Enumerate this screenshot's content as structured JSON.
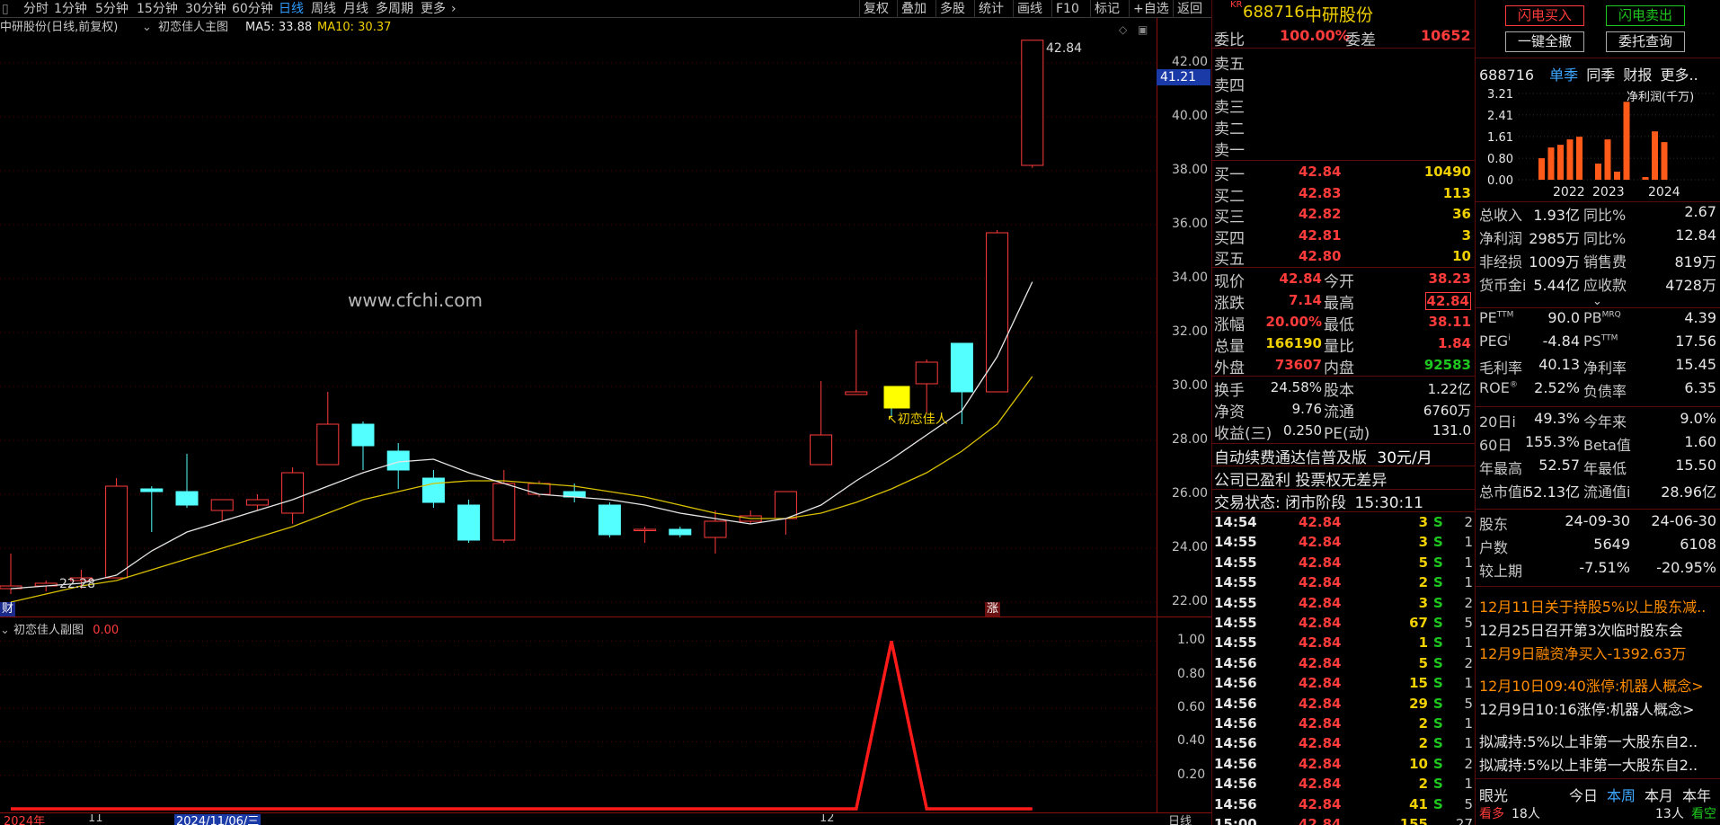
{
  "toolbar": {
    "periods": [
      "分时",
      "1分钟",
      "5分钟",
      "15分钟",
      "30分钟",
      "60分钟",
      "日线",
      "周线",
      "月线",
      "多周期",
      "更多"
    ],
    "active": "日线",
    "right_buttons": [
      "复权",
      "叠加",
      "多股",
      "统计",
      "画线",
      "F10",
      "标记",
      "+自选",
      "返回"
    ]
  },
  "chart": {
    "title": "中研股份(日线,前复权)",
    "indicator": "初恋佳人主图",
    "ma5_label": "MA5: 33.88",
    "ma10_label": "MA10: 30.37",
    "watermark": "www.cfchi.com",
    "high_label": "42.84",
    "low_label": "22.28",
    "marker_label": "初恋佳人",
    "current_price_tag": "41.21",
    "cai_tag": "财",
    "zhang_tag": "涨",
    "yaxis_ticks": [
      "42.00",
      "40.00",
      "38.00",
      "36.00",
      "34.00",
      "32.00",
      "30.00",
      "28.00",
      "26.00",
      "24.00",
      "22.00"
    ],
    "sub_title": "初恋佳人副图",
    "sub_value": "0.00",
    "sub_ticks": [
      "1.00",
      "0.80",
      "0.60",
      "0.40",
      "0.20"
    ],
    "date_labels": [
      "2024年",
      "11",
      "2024/11/06/三",
      "12"
    ],
    "axis_unit": "日线"
  },
  "chart_data": {
    "type": "candlestick",
    "candles": [
      {
        "o": 22.5,
        "h": 23.8,
        "l": 22.3,
        "c": 22.6
      },
      {
        "o": 22.6,
        "h": 22.8,
        "l": 22.4,
        "c": 22.7
      },
      {
        "o": 22.8,
        "h": 23.2,
        "l": 22.5,
        "c": 22.9
      },
      {
        "o": 22.9,
        "h": 26.6,
        "l": 22.9,
        "c": 26.3
      },
      {
        "o": 26.2,
        "h": 26.3,
        "l": 24.6,
        "c": 26.1
      },
      {
        "o": 26.1,
        "h": 27.5,
        "l": 25.5,
        "c": 25.6
      },
      {
        "o": 25.4,
        "h": 25.8,
        "l": 25.0,
        "c": 25.8
      },
      {
        "o": 25.6,
        "h": 26.0,
        "l": 25.4,
        "c": 25.8
      },
      {
        "o": 25.3,
        "h": 27.0,
        "l": 24.9,
        "c": 26.8
      },
      {
        "o": 27.1,
        "h": 29.8,
        "l": 27.1,
        "c": 28.6
      },
      {
        "o": 28.6,
        "h": 28.7,
        "l": 26.9,
        "c": 27.8
      },
      {
        "o": 27.6,
        "h": 27.9,
        "l": 26.2,
        "c": 26.9
      },
      {
        "o": 26.6,
        "h": 26.9,
        "l": 25.5,
        "c": 25.7
      },
      {
        "o": 25.6,
        "h": 25.8,
        "l": 24.2,
        "c": 24.3
      },
      {
        "o": 24.3,
        "h": 26.9,
        "l": 24.2,
        "c": 26.4
      },
      {
        "o": 26.0,
        "h": 26.5,
        "l": 25.9,
        "c": 26.4
      },
      {
        "o": 26.1,
        "h": 26.4,
        "l": 25.7,
        "c": 25.9
      },
      {
        "o": 25.6,
        "h": 25.7,
        "l": 24.4,
        "c": 24.5
      },
      {
        "o": 24.7,
        "h": 24.8,
        "l": 24.2,
        "c": 24.7
      },
      {
        "o": 24.7,
        "h": 24.8,
        "l": 24.4,
        "c": 24.5
      },
      {
        "o": 24.4,
        "h": 25.4,
        "l": 23.8,
        "c": 25.0
      },
      {
        "o": 25.0,
        "h": 25.4,
        "l": 24.9,
        "c": 25.2
      },
      {
        "o": 25.1,
        "h": 26.1,
        "l": 24.5,
        "c": 26.1
      },
      {
        "o": 27.1,
        "h": 30.2,
        "l": 27.1,
        "c": 28.2
      },
      {
        "o": 29.7,
        "h": 32.1,
        "l": 29.7,
        "c": 29.8
      },
      {
        "o": 30.0,
        "h": 30.0,
        "l": 28.9,
        "c": 29.2
      },
      {
        "o": 30.1,
        "h": 31.0,
        "l": 29.0,
        "c": 30.9
      },
      {
        "o": 31.6,
        "h": 31.6,
        "l": 28.6,
        "c": 29.8
      },
      {
        "o": 29.8,
        "h": 35.8,
        "l": 29.8,
        "c": 35.7
      },
      {
        "o": 38.2,
        "h": 42.84,
        "l": 38.11,
        "c": 42.84
      }
    ],
    "ma_short": [
      22.5,
      22.6,
      22.7,
      23.0,
      23.9,
      24.6,
      25.0,
      25.4,
      25.8,
      26.3,
      26.8,
      27.2,
      27.3,
      26.8,
      26.4,
      26.0,
      25.9,
      25.8,
      25.6,
      25.3,
      25.1,
      24.9,
      25.1,
      25.6,
      26.5,
      27.3,
      28.2,
      29.1,
      31.1,
      33.88
    ],
    "ma_long": [
      22.0,
      22.3,
      22.6,
      22.8,
      23.2,
      23.6,
      24.0,
      24.4,
      24.8,
      25.3,
      25.8,
      26.1,
      26.4,
      26.5,
      26.5,
      26.4,
      26.3,
      26.1,
      25.9,
      25.6,
      25.3,
      25.1,
      25.1,
      25.3,
      25.7,
      26.2,
      26.8,
      27.6,
      28.6,
      30.37
    ],
    "sub_series": [
      0,
      0,
      0,
      0,
      0,
      0,
      0,
      0,
      0,
      0,
      0,
      0,
      0,
      0,
      0,
      0,
      0,
      0,
      0,
      0,
      0,
      0,
      0,
      0,
      0,
      1,
      0,
      0,
      0,
      0
    ],
    "ylim": [
      21.5,
      43
    ],
    "sub_ylim": [
      0,
      1.05
    ]
  },
  "quote": {
    "badge": "KR",
    "code": "688716",
    "name": "中研股份",
    "webi_label": "委比",
    "webi": "100.00%",
    "wecha_label": "委差",
    "wecha": "10652",
    "sells": [
      {
        "label": "卖五"
      },
      {
        "label": "卖四"
      },
      {
        "label": "卖三"
      },
      {
        "label": "卖二"
      },
      {
        "label": "卖一"
      }
    ],
    "buys": [
      {
        "label": "买一",
        "price": "42.84",
        "vol": "10490"
      },
      {
        "label": "买二",
        "price": "42.83",
        "vol": "113"
      },
      {
        "label": "买三",
        "price": "42.82",
        "vol": "36"
      },
      {
        "label": "买四",
        "price": "42.81",
        "vol": "3"
      },
      {
        "label": "买五",
        "price": "42.80",
        "vol": "10"
      }
    ],
    "stats": [
      {
        "l1": "现价",
        "v1": "42.84",
        "c1": "red",
        "l2": "今开",
        "v2": "38.23",
        "c2": "red"
      },
      {
        "l1": "涨跌",
        "v1": "7.14",
        "c1": "red",
        "l2": "最高",
        "v2": "42.84",
        "c2": "red"
      },
      {
        "l1": "涨幅",
        "v1": "20.00%",
        "c1": "red",
        "l2": "最低",
        "v2": "38.11",
        "c2": "red"
      },
      {
        "l1": "总量",
        "v1": "166190",
        "c1": "yellow",
        "l2": "量比",
        "v2": "1.84",
        "c2": "red"
      },
      {
        "l1": "外盘",
        "v1": "73607",
        "c1": "red",
        "l2": "内盘",
        "v2": "92583",
        "c2": "green"
      }
    ],
    "stats2": [
      {
        "l1": "换手",
        "v1": "24.58%",
        "l2": "股本",
        "v2": "1.22亿"
      },
      {
        "l1": "净资",
        "v1": "9.76",
        "l2": "流通",
        "v2": "6760万"
      },
      {
        "l1": "收益(三)",
        "v1": "0.250",
        "l2": "PE(动)",
        "v2": "131.0"
      }
    ],
    "promo": "自动续费通达信普及版",
    "price_tag": "30元/月",
    "notice": "公司已盈利 投票权无差异",
    "trade_state_label": "交易状态:",
    "trade_state": "闭市阶段",
    "trade_time": "15:30:11",
    "ticks": [
      {
        "t": "14:54",
        "p": "42.84",
        "v": "3",
        "s": "S",
        "n": "2"
      },
      {
        "t": "14:55",
        "p": "42.84",
        "v": "3",
        "s": "S",
        "n": "1"
      },
      {
        "t": "14:55",
        "p": "42.84",
        "v": "5",
        "s": "S",
        "n": "1"
      },
      {
        "t": "14:55",
        "p": "42.84",
        "v": "2",
        "s": "S",
        "n": "1"
      },
      {
        "t": "14:55",
        "p": "42.84",
        "v": "3",
        "s": "S",
        "n": "2"
      },
      {
        "t": "14:55",
        "p": "42.84",
        "v": "67",
        "s": "S",
        "n": "5"
      },
      {
        "t": "14:55",
        "p": "42.84",
        "v": "1",
        "s": "S",
        "n": "1"
      },
      {
        "t": "14:56",
        "p": "42.84",
        "v": "5",
        "s": "S",
        "n": "2"
      },
      {
        "t": "14:56",
        "p": "42.84",
        "v": "15",
        "s": "S",
        "n": "1"
      },
      {
        "t": "14:56",
        "p": "42.84",
        "v": "29",
        "s": "S",
        "n": "5"
      },
      {
        "t": "14:56",
        "p": "42.84",
        "v": "2",
        "s": "S",
        "n": "1"
      },
      {
        "t": "14:56",
        "p": "42.84",
        "v": "2",
        "s": "S",
        "n": "1"
      },
      {
        "t": "14:56",
        "p": "42.84",
        "v": "10",
        "s": "S",
        "n": "2"
      },
      {
        "t": "14:56",
        "p": "42.84",
        "v": "2",
        "s": "S",
        "n": "1"
      },
      {
        "t": "14:56",
        "p": "42.84",
        "v": "41",
        "s": "S",
        "n": "5"
      },
      {
        "t": "15:00",
        "p": "42.84",
        "v": "155",
        "s": "",
        "n": "27"
      }
    ]
  },
  "fin": {
    "btn_buy": "闪电买入",
    "btn_sell": "闪电卖出",
    "btn_cancel": "一键全撤",
    "btn_query": "委托查询",
    "code": "688716",
    "tabs": [
      "单季",
      "同季",
      "财报",
      "更多.."
    ],
    "chart_title": "净利润(千万)",
    "yticks": [
      "3.21",
      "2.41",
      "1.61",
      "0.80",
      "0.00"
    ],
    "years": [
      "2022",
      "2023",
      "2024"
    ],
    "bars": [
      0.8,
      1.2,
      1.3,
      1.5,
      1.6,
      0,
      0.6,
      1.5,
      0.3,
      2.9,
      0,
      0.1,
      1.8,
      1.4
    ],
    "rows": [
      {
        "a": "总收入",
        "b": "1.93亿",
        "c": "同比%",
        "d": "2.67"
      },
      {
        "a": "净利润",
        "b": "2985万",
        "c": "同比%",
        "d": "12.84"
      },
      {
        "a": "非经损",
        "b": "1009万",
        "c": "销售费",
        "d": "819万"
      },
      {
        "a": "货币金i",
        "b": "5.44亿",
        "c": "应收款",
        "d": "4728万"
      }
    ],
    "rows2": [
      {
        "a": "PE",
        "sup": "TTM",
        "b": "90.0",
        "c": "PB",
        "csup": "MRQ",
        "d": "4.39"
      },
      {
        "a": "PEG",
        "sup": "i",
        "b": "-4.84",
        "c": "PS",
        "csup": "TTM",
        "d": "17.56"
      },
      {
        "a": "毛利率",
        "sup": "",
        "b": "40.13",
        "c": "净利率",
        "csup": "",
        "d": "15.45"
      },
      {
        "a": "ROE",
        "sup": "®",
        "b": "2.52%",
        "c": "负债率",
        "csup": "",
        "d": "6.35"
      }
    ],
    "rows3": [
      {
        "a": "20日i",
        "b": "49.3%",
        "c": "今年来",
        "d": "9.0%"
      },
      {
        "a": "60日",
        "b": "155.3%",
        "c": "Beta值",
        "d": "1.60"
      },
      {
        "a": "年最高",
        "b": "52.57",
        "c": "年最低",
        "d": "15.50"
      },
      {
        "a": "总市值i",
        "b": "52.13亿",
        "c": "流通值i",
        "d": "28.96亿"
      }
    ],
    "holders": {
      "label": "股东",
      "d1": "24-09-30",
      "d2": "24-06-30",
      "rows": [
        {
          "a": "户数",
          "b": "5649",
          "c": "6108"
        },
        {
          "a": "较上期",
          "b": "-7.51%",
          "c": "-20.95%"
        }
      ]
    },
    "news": [
      "12月11日关于持股5%以上股东减..",
      "12月25日召开第3次临时股东会",
      "12月9日融资净买入-1392.63万",
      "12月10日09:40涨停:机器人概念>",
      "12月9日10:16涨停:机器人概念>",
      "拟减持:5%以上非第一大股东自2..",
      "拟减持:5%以上非第一大股东自2.."
    ],
    "bottom": {
      "label": "眼光",
      "tabs": [
        "今日",
        "本周",
        "本月",
        "本年"
      ],
      "kan": "看多",
      "kan_n": "18人",
      "n2": "13人",
      "kong": "看空"
    }
  }
}
